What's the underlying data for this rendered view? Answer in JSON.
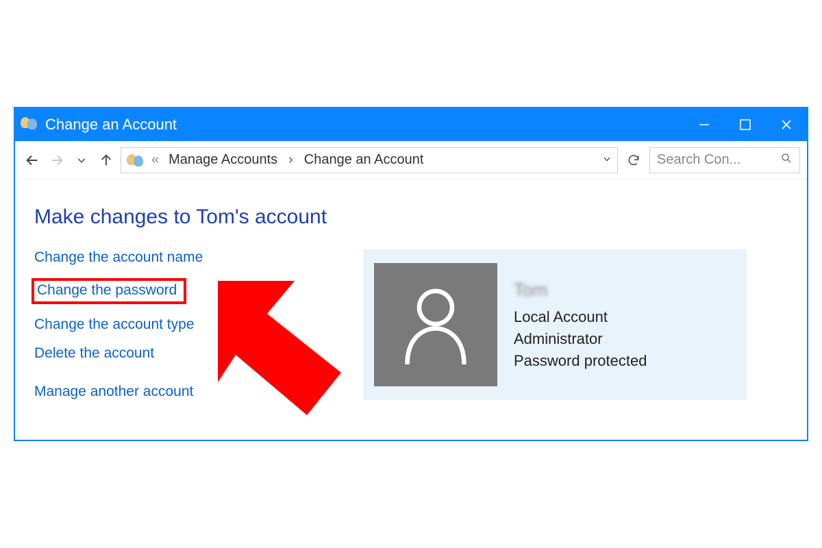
{
  "titlebar": {
    "title": "Change an Account"
  },
  "toolbar": {
    "crumb_prefix": "«",
    "crumb1": "Manage Accounts",
    "crumb2": "Change an Account",
    "search_placeholder": "Search Con..."
  },
  "content": {
    "heading": "Make changes to Tom's account",
    "links": {
      "change_name": "Change the account name",
      "change_password": "Change the password",
      "change_type": "Change the account type",
      "delete_account": "Delete the account",
      "manage_another": "Manage another account"
    },
    "user": {
      "name": "Tom",
      "line1": "Local Account",
      "line2": "Administrator",
      "line3": "Password protected"
    }
  }
}
